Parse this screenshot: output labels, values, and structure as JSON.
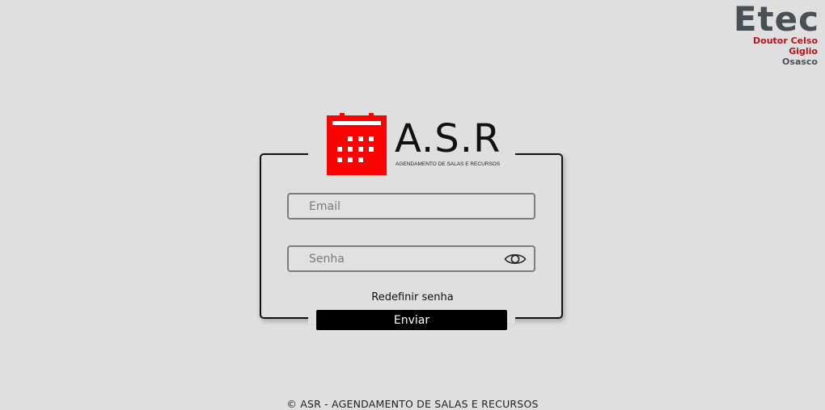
{
  "header": {
    "etec_logo": {
      "word": "Etec",
      "line1": "Doutor Celso",
      "line2": "Giglio",
      "line3": "Osasco"
    }
  },
  "brand": {
    "logo_icon": "calendar-icon",
    "title": "A.S.R",
    "subtitle": "AGENDAMENTO DE SALAS E RECURSOS",
    "accent_color": "#ff0000"
  },
  "form": {
    "email_placeholder": "Email",
    "email_value": "",
    "password_placeholder": "Senha",
    "password_value": "",
    "toggle_icon": "eye-icon",
    "reset_label": "Redefinir senha",
    "submit_label": "Enviar"
  },
  "footer": {
    "text": "© ASR - AGENDAMENTO DE SALAS E RECURSOS"
  }
}
